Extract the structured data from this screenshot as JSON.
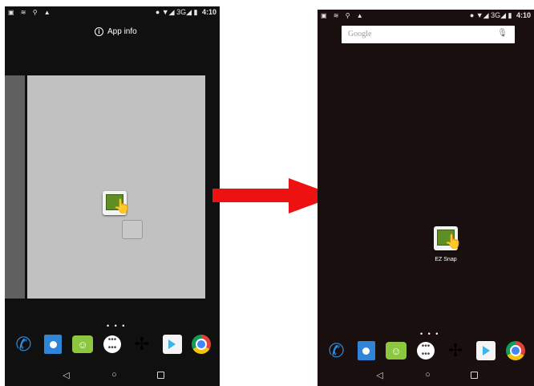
{
  "left_phone": {
    "status_left": "▣ ≋ ⚲ ▲",
    "status_right": "● ▼◢ 3G◢ ▮",
    "time": "4:10",
    "app_info_label": "App info",
    "page_dots": "• • •",
    "nav": {
      "back": "◁",
      "home": "○"
    }
  },
  "right_phone": {
    "status_left": "▣ ≋ ⚲ ▲",
    "status_right": "● ▼◢ 3G◢ ▮",
    "time": "4:10",
    "search_placeholder": "Google",
    "app_label": "EZ Snap",
    "page_dots": "• • •",
    "nav": {
      "back": "◁",
      "home": "○"
    }
  },
  "dock_icons": [
    "phone-icon",
    "contacts-icon",
    "messaging-icon",
    "all-apps-icon",
    "photos-icon",
    "play-store-icon",
    "chrome-icon"
  ],
  "colors": {
    "arrow": "#ee1111",
    "page_preview": "#c1c1c1",
    "ezsnap_green": "#5f8e24"
  }
}
